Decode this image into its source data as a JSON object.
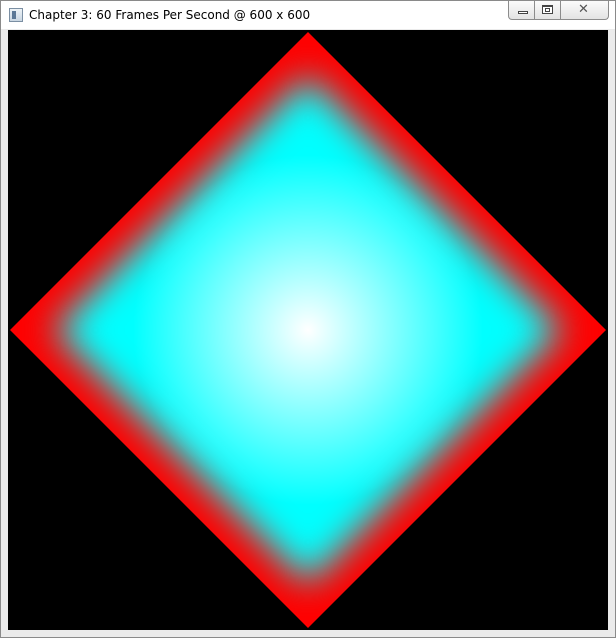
{
  "window": {
    "title": "Chapter 3: 60 Frames Per Second @ 600 x 600",
    "icon": "app-window-icon",
    "controls": {
      "minimize_icon": "minimize-icon",
      "maximize_icon": "maximize-icon",
      "close_icon": "close-icon",
      "close_glyph": "✕"
    }
  },
  "scene": {
    "shape": "diamond",
    "background_color": "#000000",
    "edge_color": "#ff0000",
    "center_color": "#ffffff",
    "body_color": "#00ffff"
  }
}
